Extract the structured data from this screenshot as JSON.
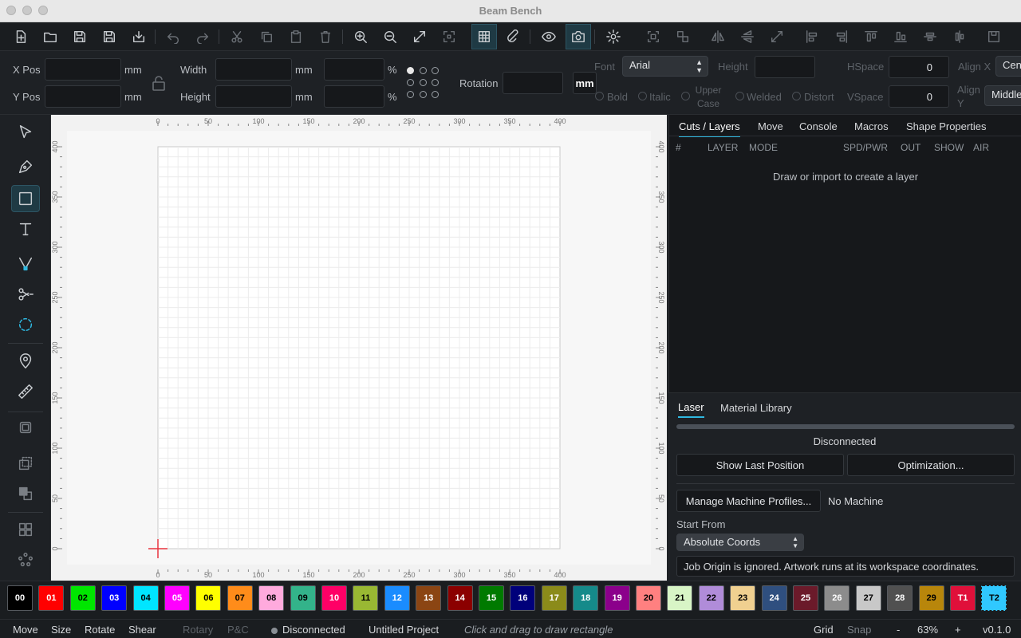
{
  "window": {
    "title": "Beam Bench"
  },
  "toolbar": {
    "items": [
      "new-file",
      "open-folder",
      "save",
      "save-as",
      "import",
      "undo",
      "redo",
      "cut",
      "copy",
      "paste",
      "delete",
      "zoom-in",
      "zoom-out",
      "fit-view",
      "frame",
      "grid",
      "magnet",
      "preview",
      "camera",
      "settings",
      "group",
      "ungroup",
      "flip-h",
      "flip-v",
      "distort",
      "align-left",
      "align-right",
      "align-top",
      "align-bottom",
      "center-h",
      "center-v",
      "export"
    ]
  },
  "props": {
    "xpos_label": "X Pos",
    "ypos_label": "Y Pos",
    "mm": "mm",
    "width_label": "Width",
    "height_label": "Height",
    "pct": "%",
    "rotation_label": "Rotation",
    "unit_btn": "mm",
    "font_label": "Font",
    "font_value": "Arial",
    "font_height_label": "Height",
    "hspace_label": "HSpace",
    "hspace_value": "0",
    "vspace_label": "VSpace",
    "vspace_value": "0",
    "alignx_label": "Align X",
    "alignx_value": "Cen",
    "aligny_label": "Align Y",
    "aligny_value": "Middle",
    "bold": "Bold",
    "italic": "Italic",
    "upper_case": "Upper Case",
    "welded": "Welded",
    "distort": "Distort"
  },
  "canvas": {
    "ruler_ticks": [
      "0",
      "50",
      "100",
      "150",
      "200",
      "250",
      "300",
      "350",
      "400"
    ]
  },
  "right_panel": {
    "tabs": [
      "Cuts / Layers",
      "Move",
      "Console",
      "Macros",
      "Shape Properties"
    ],
    "columns": [
      "#",
      "LAYER",
      "MODE",
      "SPD/PWR",
      "OUT",
      "SHOW",
      "AIR"
    ],
    "empty_text": "Draw or import to create a layer"
  },
  "laser_panel": {
    "tabs": [
      "Laser",
      "Material Library"
    ],
    "status": "Disconnected",
    "show_last_position": "Show Last Position",
    "optimization": "Optimization...",
    "manage_profiles": "Manage Machine Profiles...",
    "machine": "No Machine",
    "start_from_label": "Start From",
    "start_from_value": "Absolute Coords",
    "job_origin_note": "Job Origin is ignored. Artwork runs at its workspace coordinates."
  },
  "palette": [
    {
      "label": "00",
      "color": "#000000",
      "text": "#ffffff"
    },
    {
      "label": "01",
      "color": "#ff0000",
      "text": "#ffffff"
    },
    {
      "label": "02",
      "color": "#00e600",
      "text": "#000000"
    },
    {
      "label": "03",
      "color": "#0000ff",
      "text": "#ffffff"
    },
    {
      "label": "04",
      "color": "#00e5ff",
      "text": "#000000"
    },
    {
      "label": "05",
      "color": "#ff00ff",
      "text": "#ffffff"
    },
    {
      "label": "06",
      "color": "#ffff00",
      "text": "#000000"
    },
    {
      "label": "07",
      "color": "#ff8c1a",
      "text": "#000000"
    },
    {
      "label": "08",
      "color": "#ffaadd",
      "text": "#000000"
    },
    {
      "label": "09",
      "color": "#33b38a",
      "text": "#000000"
    },
    {
      "label": "10",
      "color": "#ff0066",
      "text": "#ffffff"
    },
    {
      "label": "11",
      "color": "#99b833",
      "text": "#000000"
    },
    {
      "label": "12",
      "color": "#1a8cff",
      "text": "#ffffff"
    },
    {
      "label": "13",
      "color": "#8b4513",
      "text": "#ffffff"
    },
    {
      "label": "14",
      "color": "#8b0000",
      "text": "#ffffff"
    },
    {
      "label": "15",
      "color": "#007a00",
      "text": "#ffffff"
    },
    {
      "label": "16",
      "color": "#00007a",
      "text": "#ffffff"
    },
    {
      "label": "17",
      "color": "#8b8b1a",
      "text": "#ffffff"
    },
    {
      "label": "18",
      "color": "#158a8a",
      "text": "#ffffff"
    },
    {
      "label": "19",
      "color": "#8b008b",
      "text": "#ffffff"
    },
    {
      "label": "20",
      "color": "#ff8080",
      "text": "#000000"
    },
    {
      "label": "21",
      "color": "#d8f5c6",
      "text": "#000000"
    },
    {
      "label": "22",
      "color": "#b08cd9",
      "text": "#000000"
    },
    {
      "label": "23",
      "color": "#f0d090",
      "text": "#000000"
    },
    {
      "label": "24",
      "color": "#2f4f7f",
      "text": "#ffffff"
    },
    {
      "label": "25",
      "color": "#6b1a2a",
      "text": "#ffffff"
    },
    {
      "label": "26",
      "color": "#8c8c8c",
      "text": "#ffffff"
    },
    {
      "label": "27",
      "color": "#c8c8c8",
      "text": "#000000"
    },
    {
      "label": "28",
      "color": "#505050",
      "text": "#ffffff"
    },
    {
      "label": "29",
      "color": "#b8860b",
      "text": "#000000"
    },
    {
      "label": "T1",
      "color": "#e0103a",
      "text": "#ffffff"
    },
    {
      "label": "T2",
      "color": "#30c8ff",
      "text": "#000000"
    }
  ],
  "status": {
    "move": "Move",
    "size": "Size",
    "rotate": "Rotate",
    "shear": "Shear",
    "rotary": "Rotary",
    "pc": "P&C",
    "connection": "Disconnected",
    "project": "Untitled Project",
    "hint": "Click and drag to draw rectangle",
    "grid": "Grid",
    "snap": "Snap",
    "zoom_minus": "-",
    "zoom": "63%",
    "zoom_plus": "+",
    "version": "v0.1.0"
  }
}
